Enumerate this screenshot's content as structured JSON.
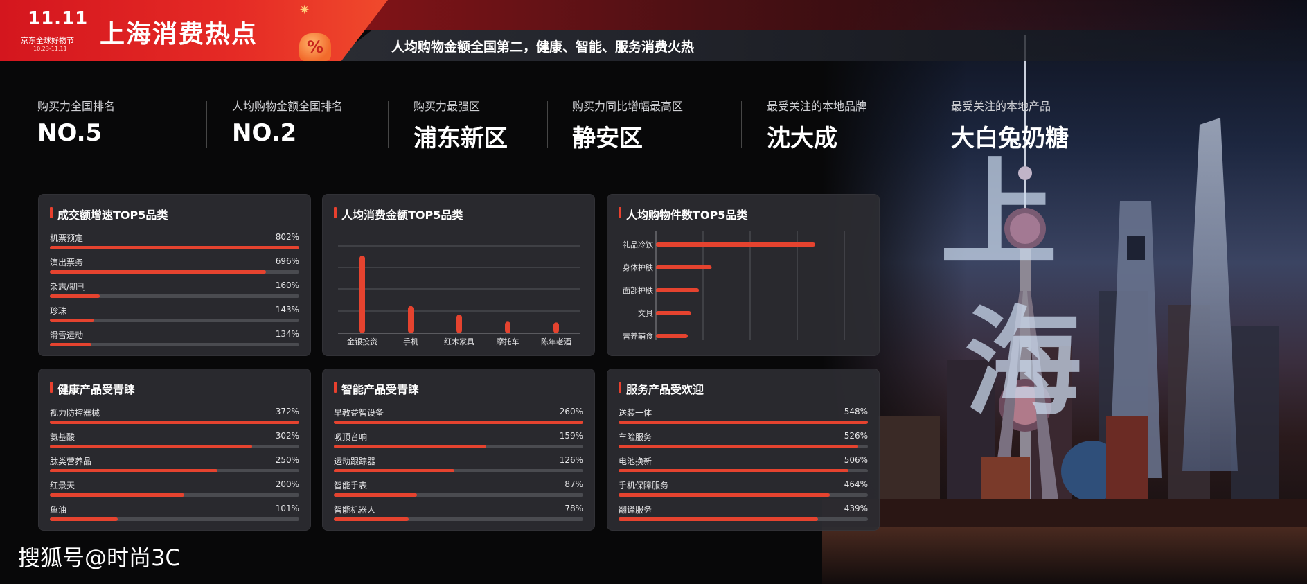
{
  "header": {
    "logo_mark": "11.11",
    "logo_text": "京东全球好物节",
    "logo_date": "10.23-11.11",
    "title": "上海消费热点",
    "pct_icon": "%",
    "star_icon": "✷",
    "subtitle": "人均购物金额全国第二，健康、智能、服务消费火热"
  },
  "stats": [
    {
      "label": "购买力全国排名",
      "value": "NO.5"
    },
    {
      "label": "人均购物金额全国排名",
      "value": "NO.2"
    },
    {
      "label": "购买力最强区",
      "value": "浦东新区"
    },
    {
      "label": "购买力同比增幅最高区",
      "value": "静安区"
    },
    {
      "label": "最受关注的本地品牌",
      "value": "沈大成"
    },
    {
      "label": "最受关注的本地产品",
      "value": "大白兔奶糖"
    }
  ],
  "background": {
    "glyph_1": "上",
    "glyph_2": "海"
  },
  "chart_data": [
    {
      "type": "bar",
      "orientation": "horizontal",
      "title": "成交额增速TOP5品类",
      "categories": [
        "机票预定",
        "演出票务",
        "杂志/期刊",
        "珍珠",
        "滑雪运动"
      ],
      "labels": [
        "802%",
        "696%",
        "160%",
        "143%",
        "134%"
      ],
      "values": [
        802,
        696,
        160,
        143,
        134
      ]
    },
    {
      "type": "bar",
      "orientation": "vertical",
      "title": "人均消费金额TOP5品类",
      "categories": [
        "金银投资",
        "手机",
        "红木家具",
        "摩托车",
        "陈年老酒"
      ],
      "values": [
        100,
        35,
        24,
        15,
        14
      ],
      "grid": true
    },
    {
      "type": "bar",
      "orientation": "horizontal",
      "title": "人均购物件数TOP5品类",
      "categories": [
        "礼品冷饮",
        "身体护肤",
        "面部护肤",
        "文具",
        "营养辅食"
      ],
      "values": [
        100,
        35,
        27,
        22,
        20
      ],
      "grid": true
    },
    {
      "type": "bar",
      "orientation": "horizontal",
      "title": "健康产品受青睐",
      "categories": [
        "视力防控器械",
        "氨基酸",
        "肽类营养品",
        "红景天",
        "鱼油"
      ],
      "labels": [
        "372%",
        "302%",
        "250%",
        "200%",
        "101%"
      ],
      "values": [
        372,
        302,
        250,
        200,
        101
      ]
    },
    {
      "type": "bar",
      "orientation": "horizontal",
      "title": "智能产品受青睐",
      "categories": [
        "早教益智设备",
        "吸顶音响",
        "运动跟踪器",
        "智能手表",
        "智能机器人"
      ],
      "labels": [
        "260%",
        "159%",
        "126%",
        "87%",
        "78%"
      ],
      "values": [
        260,
        159,
        126,
        87,
        78
      ]
    },
    {
      "type": "bar",
      "orientation": "horizontal",
      "title": "服务产品受欢迎",
      "categories": [
        "送装一体",
        "车险服务",
        "电池换新",
        "手机保障服务",
        "翻译服务"
      ],
      "labels": [
        "548%",
        "526%",
        "506%",
        "464%",
        "439%"
      ],
      "values": [
        548,
        526,
        506,
        464,
        439
      ]
    }
  ],
  "watermark": "搜狐号@时尚3C",
  "colors": {
    "accent": "#e5432f",
    "panel": "#2c2d32",
    "track": "#4a4b50",
    "header_red": "#e52a25"
  }
}
